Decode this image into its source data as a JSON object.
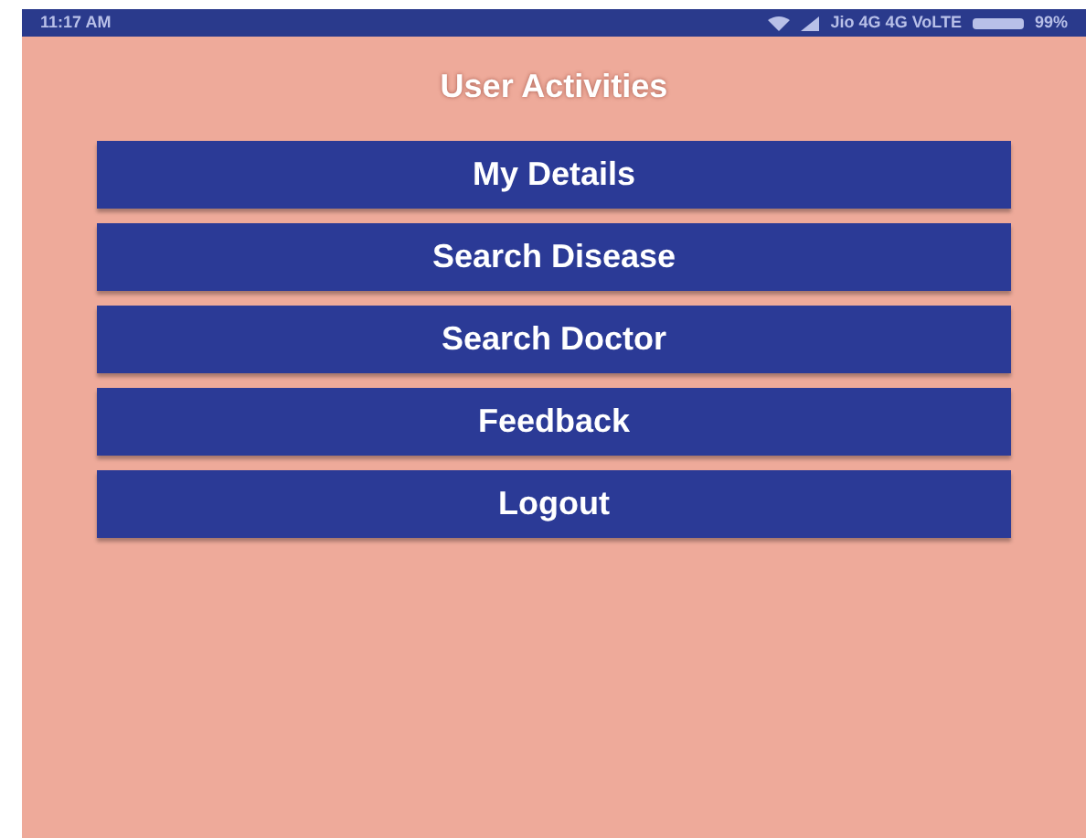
{
  "status_bar": {
    "time": "11:17 AM",
    "carrier": "Jio 4G 4G VoLTE",
    "battery": "99%"
  },
  "title": "User Activities",
  "buttons": [
    "My Details",
    "Search Disease",
    "Search Doctor",
    "Feedback",
    "Logout"
  ]
}
